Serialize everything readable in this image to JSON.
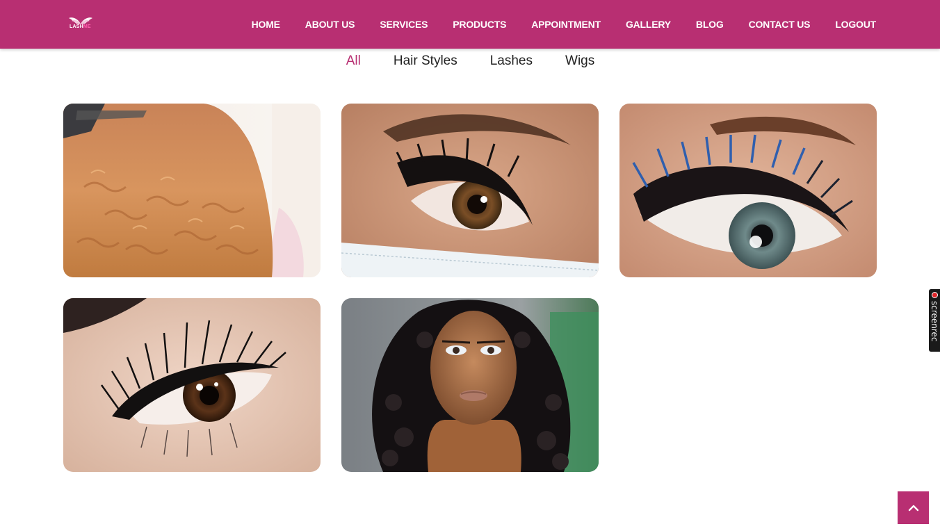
{
  "header": {
    "logo_text_white": "LASH",
    "logo_text_accent": "ME",
    "background": "#b82f72"
  },
  "nav": {
    "items": [
      {
        "label": "HOME"
      },
      {
        "label": "ABOUT US"
      },
      {
        "label": "SERVICES"
      },
      {
        "label": "PRODUCTS"
      },
      {
        "label": "APPOINTMENT"
      },
      {
        "label": "GALLERY"
      },
      {
        "label": "BLOG"
      },
      {
        "label": "CONTACT US"
      },
      {
        "label": "LOGOUT"
      }
    ]
  },
  "filters": {
    "items": [
      {
        "label": "All",
        "active": true
      },
      {
        "label": "Hair Styles",
        "active": false
      },
      {
        "label": "Lashes",
        "active": false
      },
      {
        "label": "Wigs",
        "active": false
      }
    ],
    "active_color": "#b82f72"
  },
  "gallery": {
    "items": [
      {
        "subject": "curled-auburn-hair",
        "category": "Hair Styles"
      },
      {
        "subject": "brown-eye-lash-extensions",
        "category": "Lashes"
      },
      {
        "subject": "blue-volume-lash-extensions",
        "category": "Lashes"
      },
      {
        "subject": "wispy-lash-extensions",
        "category": "Lashes"
      },
      {
        "subject": "curly-bob-wig",
        "category": "Wigs"
      }
    ]
  },
  "back_to_top": {
    "icon": "chevron-up-icon"
  },
  "screenrec": {
    "label": "screenrec"
  }
}
